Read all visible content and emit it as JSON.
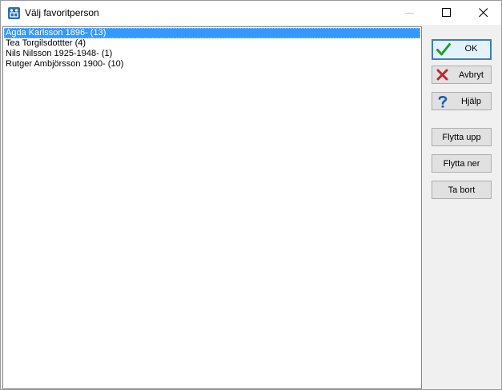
{
  "window": {
    "title": "Välj favoritperson"
  },
  "list": {
    "items": [
      {
        "label": "Agda Karlsson 1896- (13)",
        "selected": true
      },
      {
        "label": "Tea Torgilsdottter  (4)",
        "selected": false
      },
      {
        "label": "Nils Nilsson 1925-1948- (1)",
        "selected": false
      },
      {
        "label": "Rutger Ambjörsson 1900- (10)",
        "selected": false
      }
    ]
  },
  "buttons": {
    "ok": {
      "label": "OK",
      "icon": "checkmark-icon",
      "color": "#1e9e2a"
    },
    "cancel": {
      "label": "Avbryt",
      "icon": "cross-icon",
      "color": "#c0262d"
    },
    "help": {
      "label": "Hjälp",
      "icon": "question-icon",
      "color": "#1b5fb0"
    },
    "move_up": {
      "label": "Flytta upp"
    },
    "move_down": {
      "label": "Flytta ner"
    },
    "remove": {
      "label": "Ta bort"
    }
  },
  "colors": {
    "selection": "#3399ff",
    "default_button_border": "#3c7fb1"
  }
}
